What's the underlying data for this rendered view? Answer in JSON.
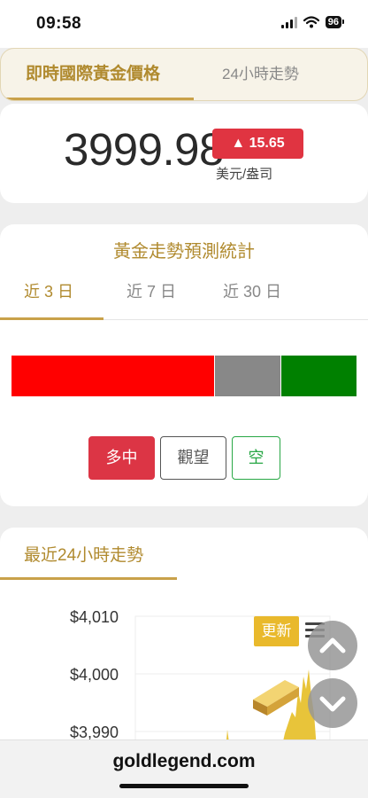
{
  "status_bar": {
    "time": "09:58",
    "battery": "96"
  },
  "top_tabs": {
    "active": "即時國際黃金價格",
    "inactive": "24小時走勢"
  },
  "price": {
    "value": "3999.98",
    "change": "▲ 15.65",
    "unit": "美元/盎司"
  },
  "stats": {
    "title": "黃金走勢預測統計",
    "periods": [
      "近 3 日",
      "近 7 日",
      "近 30 日"
    ],
    "active_period": 0,
    "distribution": {
      "long": 0.59,
      "neutral": 0.19,
      "short": 0.22
    },
    "buttons": {
      "long": "多中",
      "neutral": "觀望",
      "short": "空"
    },
    "colors": {
      "long": "#ff0000",
      "neutral": "#888888",
      "short": "#008000"
    }
  },
  "chart": {
    "title": "最近24小時走勢",
    "refresh_label": "更新",
    "chart_data": {
      "type": "area",
      "y_ticks": [
        "$4,010",
        "$4,000",
        "$3,990"
      ],
      "ylim": [
        3990,
        4010
      ],
      "color": "#e8c43a"
    }
  },
  "icons": {
    "menu": "hamburger-menu-icon",
    "scroll_up": "chevron-up-icon",
    "scroll_down": "chevron-down-icon",
    "gold_bar": "gold-bar-icon"
  },
  "browser": {
    "url": "goldlegend.com"
  }
}
